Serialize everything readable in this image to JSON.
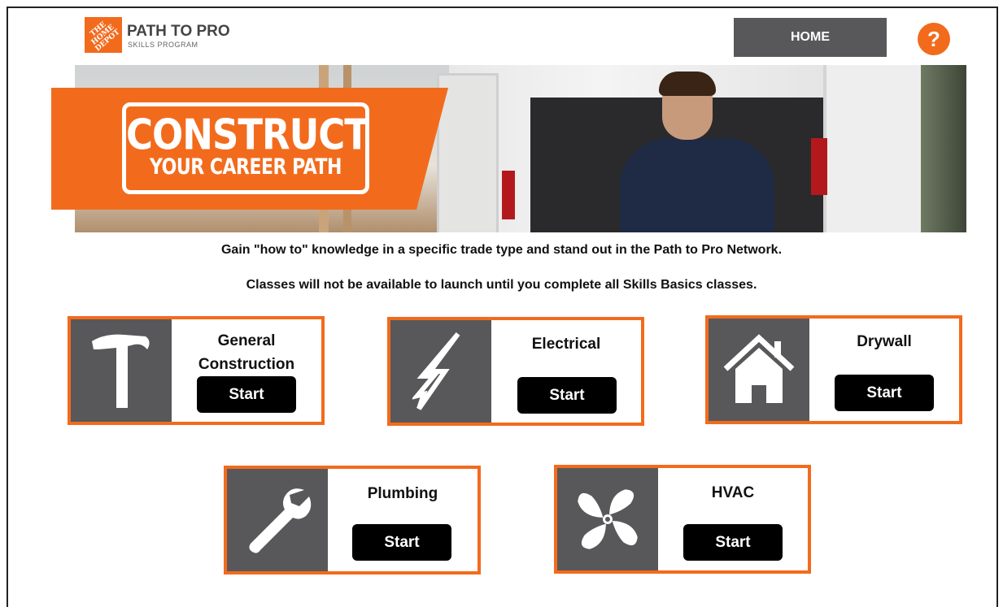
{
  "header": {
    "logo_text": "THE HOME DEPOT",
    "brand_title": "PATH TO PRO",
    "brand_subtitle": "SKILLS PROGRAM",
    "home_label": "HOME",
    "help_label": "?"
  },
  "banner": {
    "line1": "CONSTRUCT",
    "line2": "YOUR CAREER PATH"
  },
  "intro": {
    "line1": "Gain \"how to\" knowledge in a specific trade type and stand out in the Path to Pro Network.",
    "line2": "Classes will not be available to launch until you complete all Skills Basics classes."
  },
  "courses": [
    {
      "title_line1": "General",
      "title_line2": "Construction",
      "button": "Start",
      "icon": "hammer-icon"
    },
    {
      "title": "Electrical",
      "button": "Start",
      "icon": "lightning-icon"
    },
    {
      "title": "Drywall",
      "button": "Start",
      "icon": "house-icon"
    },
    {
      "title": "Plumbing",
      "button": "Start",
      "icon": "wrench-icon"
    },
    {
      "title": "HVAC",
      "button": "Start",
      "icon": "fan-icon"
    }
  ],
  "colors": {
    "accent": "#f26b1d",
    "icon_panel": "#58585a",
    "button": "#000000",
    "home_button": "#58585a"
  }
}
